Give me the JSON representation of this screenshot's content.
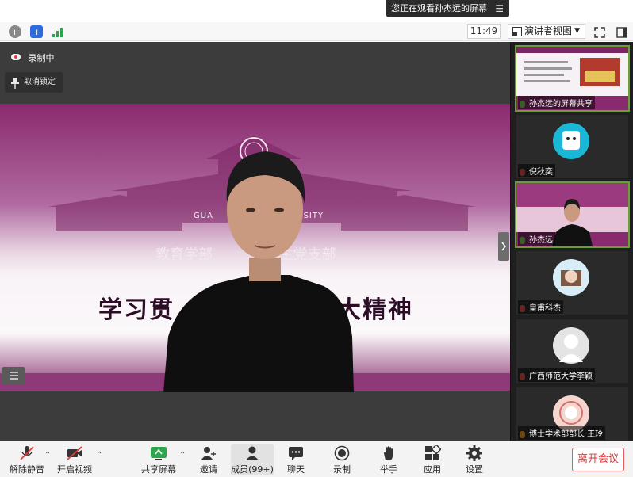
{
  "notice": {
    "text": "您正在观看孙杰远的屏幕",
    "menu_icon": "menu-icon"
  },
  "toolbar": {
    "time": "11:49",
    "view_label": "演讲者视图"
  },
  "stage": {
    "recording": "录制中",
    "unpin": "取消锁定",
    "share_subtitle": "教育学部",
    "share_subtitle_right": "生党支部",
    "share_title_left": "学习贯",
    "share_title_right": "大精神",
    "share_brand_left": "GUA",
    "share_brand_right": "ERSITY"
  },
  "participants": [
    {
      "name": "孙杰远的屏幕共享"
    },
    {
      "name": "倪秋奕"
    },
    {
      "name": "孙杰远"
    },
    {
      "name": "皇甫科杰"
    },
    {
      "name": "广西师范大学李颖"
    },
    {
      "name": "博士学术部部长  王玲"
    }
  ],
  "bottom": {
    "mute": "解除静音",
    "video": "开启视频",
    "share": "共享屏幕",
    "invite": "邀请",
    "members": "成员(99+)",
    "chat": "聊天",
    "record": "录制",
    "raise": "举手",
    "apps": "应用",
    "settings": "设置",
    "leave": "离开会议"
  },
  "colors": {
    "accent_green": "#6b9f35",
    "leave_red": "#e03a3a",
    "brand_purple": "#8a2a6e"
  }
}
